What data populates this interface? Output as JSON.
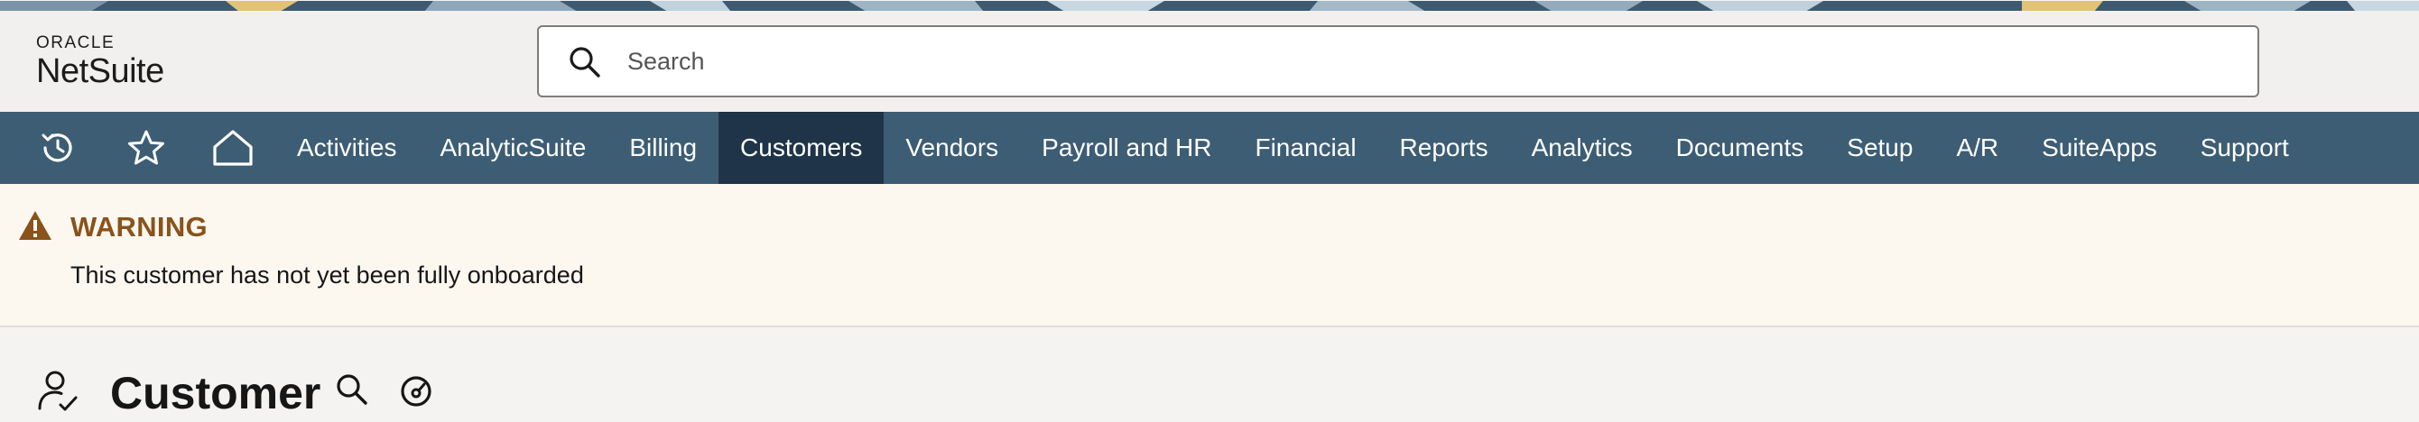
{
  "brand": {
    "company": "ORACLE",
    "product": "NetSuite"
  },
  "search": {
    "placeholder": "Search",
    "icon": "search-icon"
  },
  "nav": {
    "icons": [
      "recent-history-icon",
      "star-icon",
      "home-icon"
    ],
    "items": [
      {
        "label": "Activities",
        "active": false
      },
      {
        "label": "AnalyticSuite",
        "active": false
      },
      {
        "label": "Billing",
        "active": false
      },
      {
        "label": "Customers",
        "active": true
      },
      {
        "label": "Vendors",
        "active": false
      },
      {
        "label": "Payroll and HR",
        "active": false
      },
      {
        "label": "Financial",
        "active": false
      },
      {
        "label": "Reports",
        "active": false
      },
      {
        "label": "Analytics",
        "active": false
      },
      {
        "label": "Documents",
        "active": false
      },
      {
        "label": "Setup",
        "active": false
      },
      {
        "label": "A/R",
        "active": false
      },
      {
        "label": "SuiteApps",
        "active": false
      },
      {
        "label": "Support",
        "active": false
      }
    ]
  },
  "warning": {
    "title": "WARNING",
    "message": "This customer has not yet been fully onboarded",
    "icon": "warning-triangle-icon"
  },
  "page": {
    "title": "Customer",
    "icons": [
      "customer-person-icon",
      "search-icon",
      "dashboard-gauge-icon"
    ]
  },
  "colors": {
    "nav_bg": "#3d5d74",
    "nav_active": "#1f3448",
    "warning_accent": "#8a531b",
    "warning_bg": "#fcf8f0",
    "page_bg": "#f4f3f1"
  }
}
